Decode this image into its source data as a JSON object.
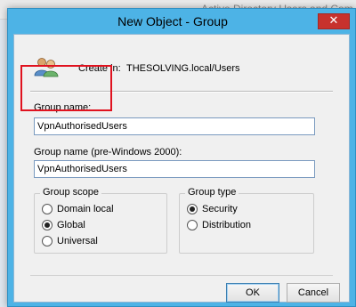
{
  "background_window": {
    "title": "Active Directory Users and Com"
  },
  "dialog": {
    "title": "New Object - Group",
    "close_glyph": "✕",
    "create_in": {
      "label": "Create in:",
      "path": "THESOLVING.local/Users"
    },
    "group_name": {
      "label": "Group name:",
      "value": "VpnAuthorisedUsers"
    },
    "group_name_pre2000": {
      "label": "Group name (pre-Windows 2000):",
      "value": "VpnAuthorisedUsers"
    },
    "group_scope": {
      "title": "Group scope",
      "options": [
        {
          "label": "Domain local",
          "checked": false
        },
        {
          "label": "Global",
          "checked": true
        },
        {
          "label": "Universal",
          "checked": false
        }
      ]
    },
    "group_type": {
      "title": "Group type",
      "options": [
        {
          "label": "Security",
          "checked": true
        },
        {
          "label": "Distribution",
          "checked": false
        }
      ]
    },
    "buttons": {
      "ok": "OK",
      "cancel": "Cancel"
    },
    "highlight_color": "#e0121f",
    "titlebar_color": "#4db3e6"
  }
}
